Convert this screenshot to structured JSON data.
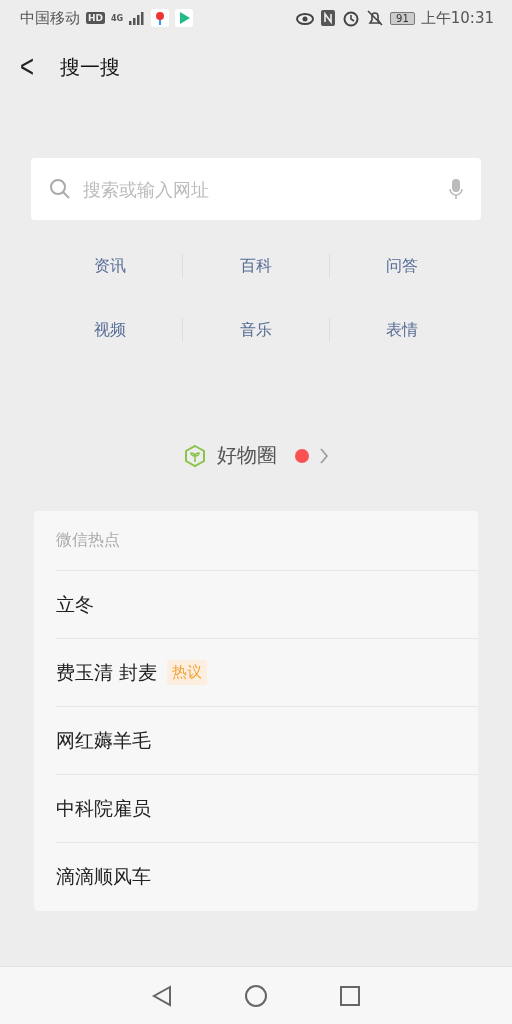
{
  "status_bar": {
    "carrier": "中国移动",
    "hd_badge": "HD",
    "network": "4G",
    "battery": "91",
    "time": "上午10:31"
  },
  "header": {
    "back": "<",
    "title": "搜一搜"
  },
  "search": {
    "placeholder": "搜索或输入网址"
  },
  "categories": [
    [
      "资讯",
      "百科",
      "问答"
    ],
    [
      "视频",
      "音乐",
      "表情"
    ]
  ],
  "good_things": {
    "label": "好物圈",
    "unread": true
  },
  "hot": {
    "title": "微信热点",
    "items": [
      {
        "text": "立冬"
      },
      {
        "text": "费玉清 封麦",
        "tag": "热议"
      },
      {
        "text": "网红薅羊毛"
      },
      {
        "text": "中科院雇员"
      },
      {
        "text": "滴滴顺风车"
      }
    ]
  }
}
